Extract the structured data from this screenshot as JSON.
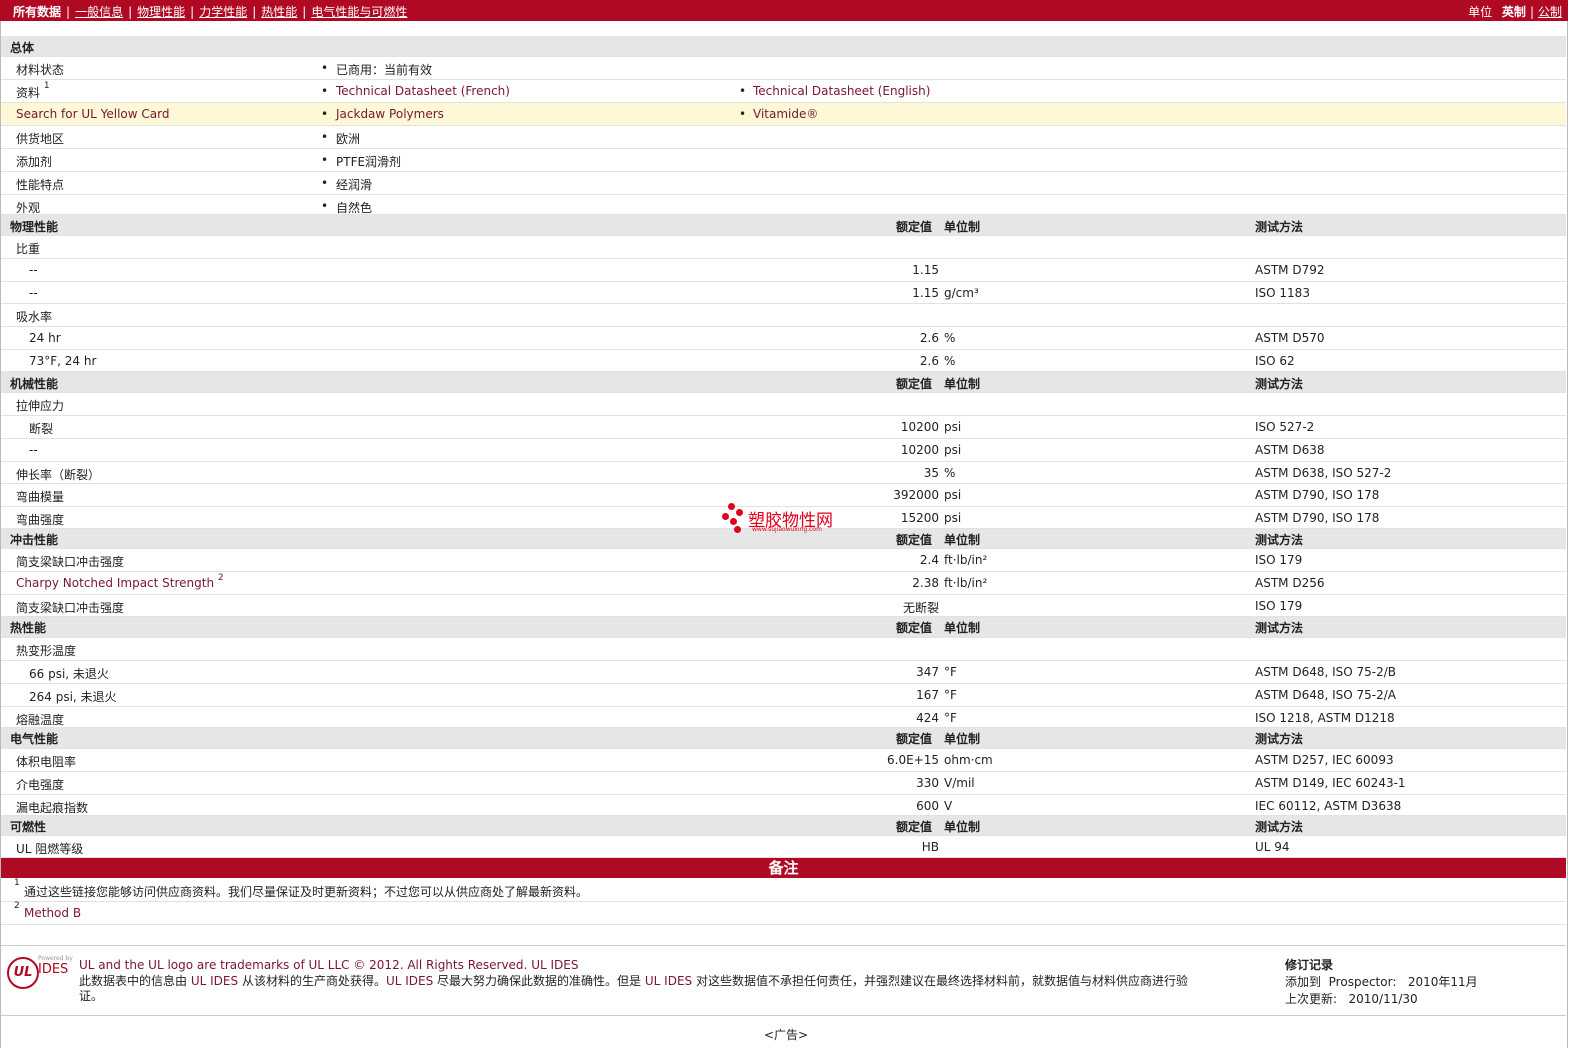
{
  "nav": {
    "all": "所有数据",
    "tabs": [
      "一般信息",
      "物理性能",
      "力学性能",
      "热性能",
      "电气性能与可燃性"
    ],
    "unit_label": "单位",
    "unit_imperial": "英制",
    "unit_metric": "公制"
  },
  "general": {
    "title": "总体",
    "status_label": "材料状态",
    "status_value": "已商用：当前有效",
    "doc_label": "资料",
    "doc_sup": "1",
    "doc_link1": "Technical Datasheet (French)",
    "doc_link2": "Technical Datasheet (English)",
    "ul_label": "Search for UL Yellow Card",
    "ul_link1": "Jackdaw Polymers",
    "ul_link2": "Vitamide®",
    "region_label": "供货地区",
    "region_value": "欧洲",
    "additive_label": "添加剂",
    "additive_value": "PTFE润滑剂",
    "feature_label": "性能特点",
    "feature_value": "经润滑",
    "appearance_label": "外观",
    "appearance_value": "自然色"
  },
  "headers": {
    "rated": "额定值",
    "unit": "单位制",
    "method": "测试方法"
  },
  "physical": {
    "title": "物理性能",
    "sg_label": "比重",
    "sg1_sub": "--",
    "sg1_val": "1.15",
    "sg1_unit": "",
    "sg1_method": "ASTM D792",
    "sg2_sub": "--",
    "sg2_val": "1.15",
    "sg2_unit": "g/cm³",
    "sg2_method": "ISO 1183",
    "wa_label": "吸水率",
    "wa1_sub": "24 hr",
    "wa1_val": "2.6",
    "wa1_unit": "%",
    "wa1_method": "ASTM D570",
    "wa2_sub": "73°F, 24 hr",
    "wa2_val": "2.6",
    "wa2_unit": "%",
    "wa2_method": "ISO 62"
  },
  "mechanical": {
    "title": "机械性能",
    "ts_label": "拉伸应力",
    "ts1_sub": "断裂",
    "ts1_val": "10200",
    "ts1_unit": "psi",
    "ts1_method": "ISO 527-2",
    "ts2_sub": "--",
    "ts2_val": "10200",
    "ts2_unit": "psi",
    "ts2_method": "ASTM D638",
    "el_label": "伸长率（断裂）",
    "el_val": "35",
    "el_unit": "%",
    "el_method": "ASTM D638, ISO 527-2",
    "fm_label": "弯曲模量",
    "fm_val": "392000",
    "fm_unit": "psi",
    "fm_method": "ASTM D790, ISO 178",
    "fs_label": "弯曲强度",
    "fs_val": "15200",
    "fs_unit": "psi",
    "fs_method": "ASTM D790, ISO 178"
  },
  "impact": {
    "title": "冲击性能",
    "i1_label": "简支梁缺口冲击强度",
    "i1_val": "2.4",
    "i1_unit": "ft·lb/in²",
    "i1_method": "ISO 179",
    "i2_label": "Charpy Notched Impact Strength",
    "i2_sup": "2",
    "i2_val": "2.38",
    "i2_unit": "ft·lb/in²",
    "i2_method": "ASTM D256",
    "i3_label": "简支梁缺口冲击强度",
    "i3_val": "无断裂",
    "i3_unit": "",
    "i3_method": "ISO 179"
  },
  "thermal": {
    "title": "热性能",
    "hdt_label": "热变形温度",
    "h1_sub": "66 psi, 未退火",
    "h1_val": "347",
    "h1_unit": "°F",
    "h1_method": "ASTM D648, ISO 75-2/B",
    "h2_sub": "264 psi, 未退火",
    "h2_val": "167",
    "h2_unit": "°F",
    "h2_method": "ASTM D648, ISO 75-2/A",
    "mt_label": "熔融温度",
    "mt_val": "424",
    "mt_unit": "°F",
    "mt_method": "ISO 1218, ASTM D1218"
  },
  "electrical": {
    "title": "电气性能",
    "e1_label": "体积电阻率",
    "e1_val": "6.0E+15",
    "e1_unit": "ohm·cm",
    "e1_method": "ASTM D257, IEC 60093",
    "e2_label": "介电强度",
    "e2_val": "330",
    "e2_unit": "V/mil",
    "e2_method": "ASTM D149, IEC 60243-1",
    "e3_label": "漏电起痕指数",
    "e3_val": "600",
    "e3_unit": "V",
    "e3_method": "IEC 60112, ASTM D3638"
  },
  "flammability": {
    "title": "可燃性",
    "f1_label": "UL 阻燃等级",
    "f1_val": "HB",
    "f1_unit": "",
    "f1_method": "UL 94"
  },
  "notes": {
    "title": "备注",
    "n1_num": "1",
    "n1_text": "通过这些链接您能够访问供应商资料。我们尽量保证及时更新资料；不过您可以从供应商处了解最新资料。",
    "n2_num": "2",
    "n2_text": "Method B"
  },
  "footer": {
    "powered": "Powered by",
    "ides": "IDES",
    "ul_logo": "UL",
    "trademark": "UL and the UL logo are trademarks of UL LLC © 2012. All Rights Reserved.",
    "trademark_link": "UL IDES",
    "disclaimer1_a": "此数据表中的信息由",
    "disclaimer1_b": "UL IDES",
    "disclaimer1_c": "从该材料的生产商处获得。",
    "disclaimer1_d": "UL IDES",
    "disclaimer1_e": "尽最大努力确保此数据的准确性。但是",
    "disclaimer1_f": "UL IDES",
    "disclaimer1_g": "对这些数据值不承担任何责任，并强烈建议在最终选择材料前，就数据值与材料供应商进行验",
    "disclaimer2": "证。",
    "rev_title": "修订记录",
    "rev_added_label": "添加到",
    "rev_added_target": "Prospector:",
    "rev_added_date": "2010年11月",
    "rev_updated_label": "上次更新:",
    "rev_updated_date": "2010/11/30",
    "ad": "<广告>"
  },
  "watermark": {
    "text": "塑胶物性网",
    "url": "www.sujiaowuxing.com"
  }
}
